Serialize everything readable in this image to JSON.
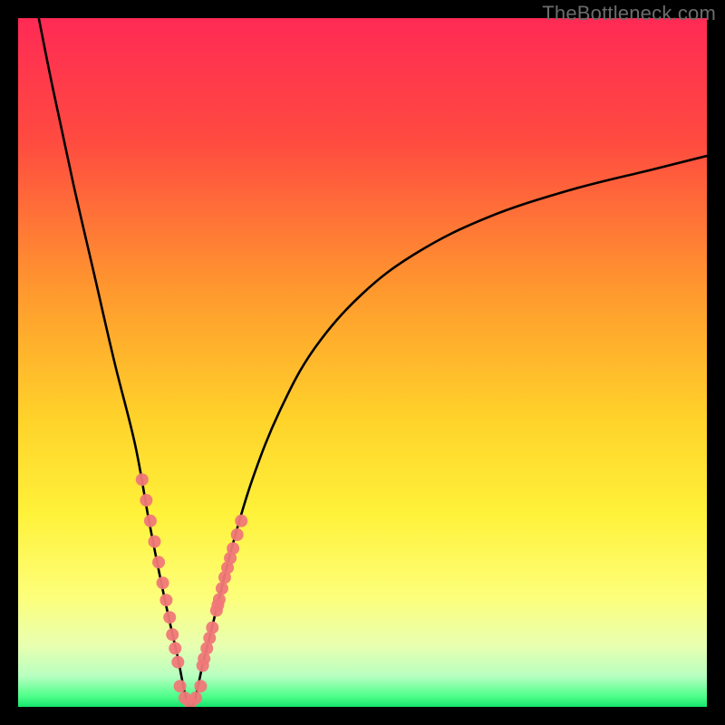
{
  "watermark": "TheBottleneck.com",
  "colors": {
    "frame": "#000000",
    "curve": "#000000",
    "dots": "#f07878",
    "gradient_stops": [
      {
        "offset": 0.0,
        "color": "#ff2a55"
      },
      {
        "offset": 0.18,
        "color": "#ff4b40"
      },
      {
        "offset": 0.4,
        "color": "#ff9a2e"
      },
      {
        "offset": 0.58,
        "color": "#ffd22a"
      },
      {
        "offset": 0.72,
        "color": "#fff23a"
      },
      {
        "offset": 0.84,
        "color": "#fdff7a"
      },
      {
        "offset": 0.91,
        "color": "#e9ffb0"
      },
      {
        "offset": 0.955,
        "color": "#b8ffc0"
      },
      {
        "offset": 0.985,
        "color": "#4dff8a"
      },
      {
        "offset": 1.0,
        "color": "#15e56c"
      }
    ]
  },
  "chart_data": {
    "type": "line",
    "title": "",
    "xlabel": "",
    "ylabel": "",
    "xlim": [
      0,
      100
    ],
    "ylim": [
      0,
      100
    ],
    "x_min_at": 25,
    "series": [
      {
        "name": "bottleneck-curve",
        "description": "V-shaped bottleneck curve; minimum near x≈25 at y≈0, rising steeply to ~100 on the left edge and asymptotically toward ~80 on the right edge.",
        "x": [
          3,
          5,
          8,
          11,
          14,
          17,
          19,
          21,
          23,
          25,
          27,
          29,
          31,
          34,
          38,
          43,
          50,
          58,
          68,
          80,
          92,
          100
        ],
        "y": [
          100,
          90,
          76,
          63,
          50,
          38,
          27,
          17,
          8,
          0,
          7,
          15,
          23,
          33,
          43,
          52,
          60,
          66,
          71,
          75,
          78,
          80
        ]
      }
    ],
    "dot_clusters": [
      {
        "name": "left-cluster",
        "x": [
          18.0,
          18.6,
          19.2,
          19.8,
          20.4,
          21.0,
          21.5,
          22.0,
          22.4,
          22.8,
          23.2
        ],
        "y": [
          33.0,
          30.0,
          27.0,
          24.0,
          21.0,
          18.0,
          15.5,
          13.0,
          10.5,
          8.5,
          6.5
        ]
      },
      {
        "name": "right-cluster",
        "x": [
          26.8,
          27.0,
          27.4,
          27.8,
          28.2,
          28.8,
          29.0,
          29.2,
          29.6,
          30.0,
          30.4,
          30.8,
          31.2,
          31.8,
          32.4
        ],
        "y": [
          6.0,
          7.0,
          8.5,
          10.0,
          11.5,
          14.0,
          14.8,
          15.6,
          17.2,
          18.8,
          20.2,
          21.6,
          23.0,
          25.0,
          27.0
        ]
      },
      {
        "name": "floor-cluster",
        "x": [
          23.5,
          24.2,
          25.0,
          25.8,
          26.5
        ],
        "y": [
          3.0,
          1.3,
          0.5,
          1.3,
          3.0
        ]
      }
    ]
  }
}
